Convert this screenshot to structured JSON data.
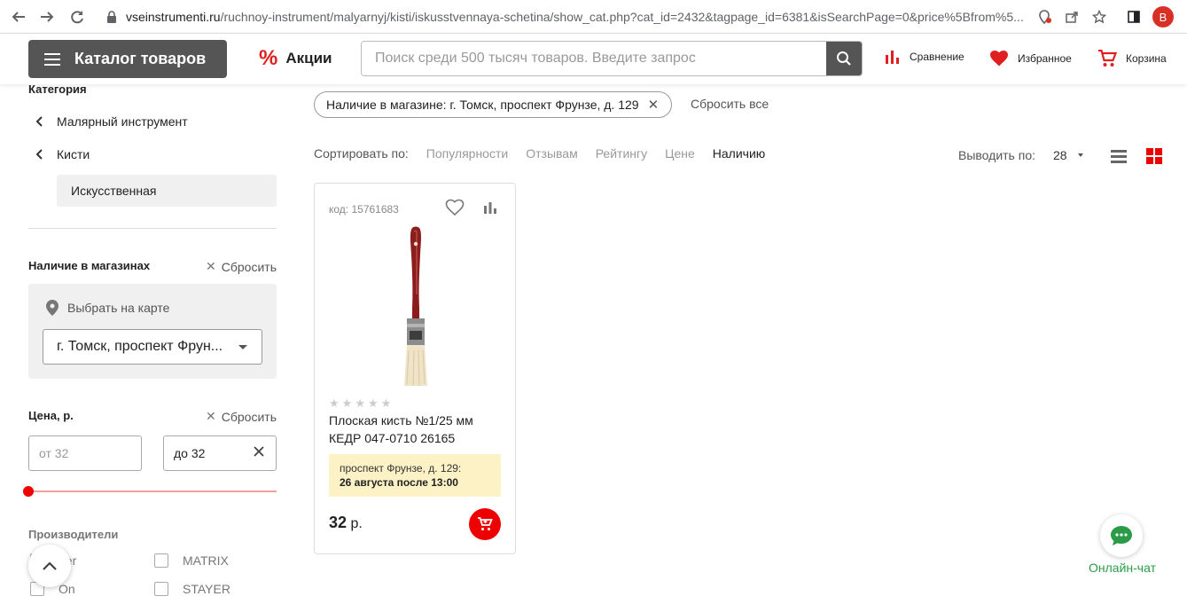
{
  "browser": {
    "url_domain": "vseinstrumenti.ru",
    "url_path": "/ruchnoy-instrument/malyarnyj/kisti/iskusstvennaya-schetina/show_cat.php?cat_id=2432&tagpage_id=6381&isSearchPage=0&price%5Bfrom%5...",
    "profile_initial": "В"
  },
  "header": {
    "catalog_label": "Каталог товаров",
    "promo_label": "Акции",
    "search_placeholder": "Поиск среди 500 тысяч товаров. Введите запрос",
    "compare_label": "Сравнение",
    "favorites_label": "Избранное",
    "cart_label": "Корзина",
    "accent_color": "#e02020"
  },
  "sidebar": {
    "category_title": "Категория",
    "categories": [
      {
        "label": "Малярный инструмент"
      },
      {
        "label": "Кисти"
      }
    ],
    "active_category": "Искусственная",
    "stores_title": "Наличие в магазинах",
    "reset_label": "Сбросить",
    "map_link": "Выбрать на карте",
    "store_selected": "г. Томск, проспект Фрун...",
    "price_title": "Цена, р.",
    "price_from_placeholder": "от 32",
    "price_to_value": "до 32",
    "brands_title": "Производители",
    "brands": [
      {
        "label": "ber"
      },
      {
        "label": "MATRIX"
      },
      {
        "label": "On"
      },
      {
        "label": "STAYER"
      }
    ]
  },
  "main": {
    "active_filter": "Наличие в магазине: г. Томск, проспект Фрунзе, д. 129",
    "reset_all": "Сбросить все",
    "sort_label": "Сортировать по:",
    "sort_options": [
      "Популярности",
      "Отзывам",
      "Рейтингу",
      "Цене",
      "Наличию"
    ],
    "sort_active": "Наличию",
    "per_page_label": "Выводить по:",
    "per_page_value": "28"
  },
  "product": {
    "code": "код: 15761683",
    "title": "Плоская кисть №1/25 мм КЕДР 047-0710 26165",
    "rating": 0,
    "avail_store": "проспект Фрунзе, д. 129:",
    "avail_date": "26 августа после 13:00",
    "price_value": "32",
    "price_unit": "р."
  },
  "chat": {
    "label": "Онлайн-чат"
  }
}
